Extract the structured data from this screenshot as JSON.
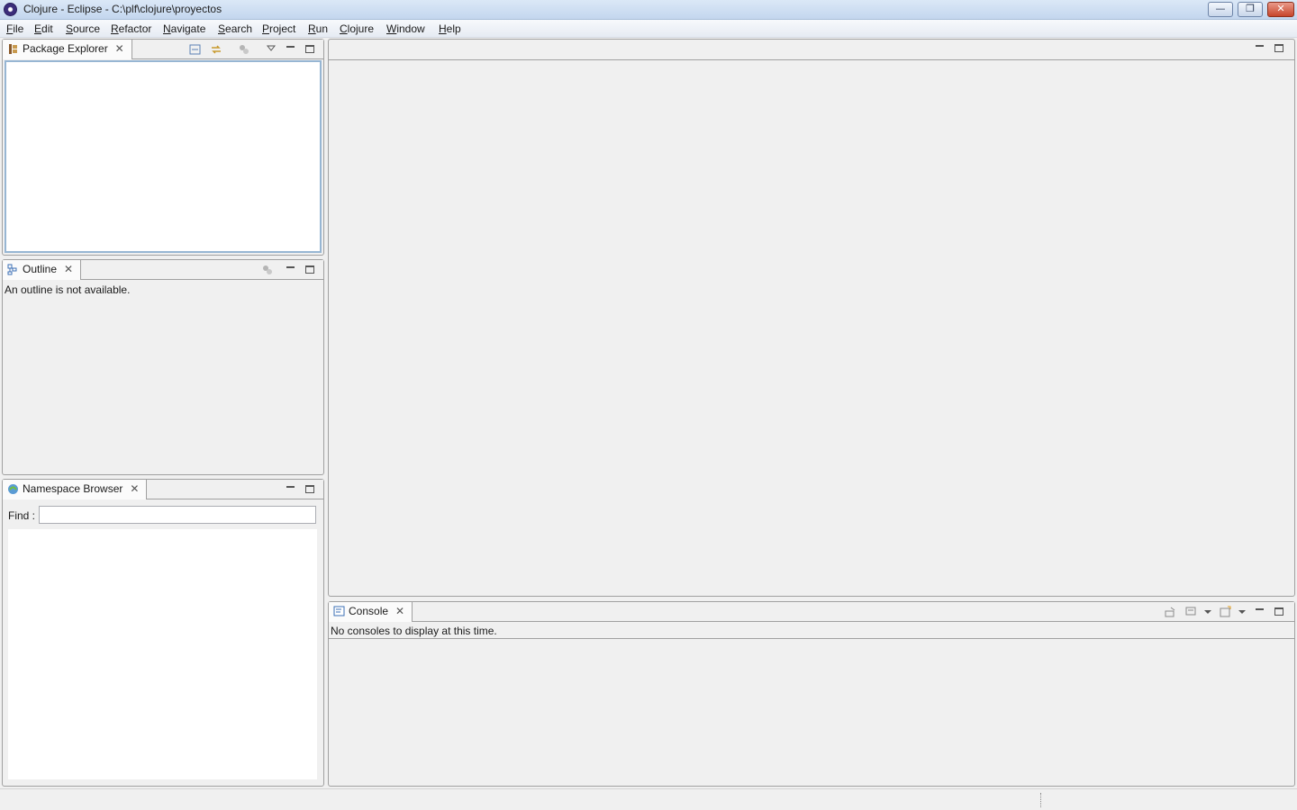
{
  "window": {
    "title": "Clojure - Eclipse - C:\\plf\\clojure\\proyectos",
    "minimize_glyph": "—",
    "restore_glyph": "❐",
    "close_glyph": "✕"
  },
  "menu": [
    "File",
    "Edit",
    "Source",
    "Refactor",
    "Navigate",
    "Search",
    "Project",
    "Run",
    "Clojure",
    "Window",
    "Help"
  ],
  "package_explorer": {
    "tab_label": "Package Explorer",
    "close_glyph": "✕",
    "icons": [
      "collapse-all-icon",
      "link-with-editor-icon",
      "focus-icon",
      "view-menu-icon",
      "minimize-icon",
      "maximize-icon"
    ]
  },
  "outline": {
    "tab_label": "Outline",
    "close_glyph": "✕",
    "message": "An outline is not available."
  },
  "namespace_browser": {
    "tab_label": "Namespace Browser",
    "close_glyph": "✕",
    "find_label": "Find :",
    "find_value": ""
  },
  "console": {
    "tab_label": "Console",
    "close_glyph": "✕",
    "message": "No consoles to display at this time."
  },
  "colors": {
    "titlebar": "#c3d6ee",
    "panel_border": "#a0a0a0",
    "focus_border": "#97b6d3",
    "background": "#f0f0f0"
  }
}
